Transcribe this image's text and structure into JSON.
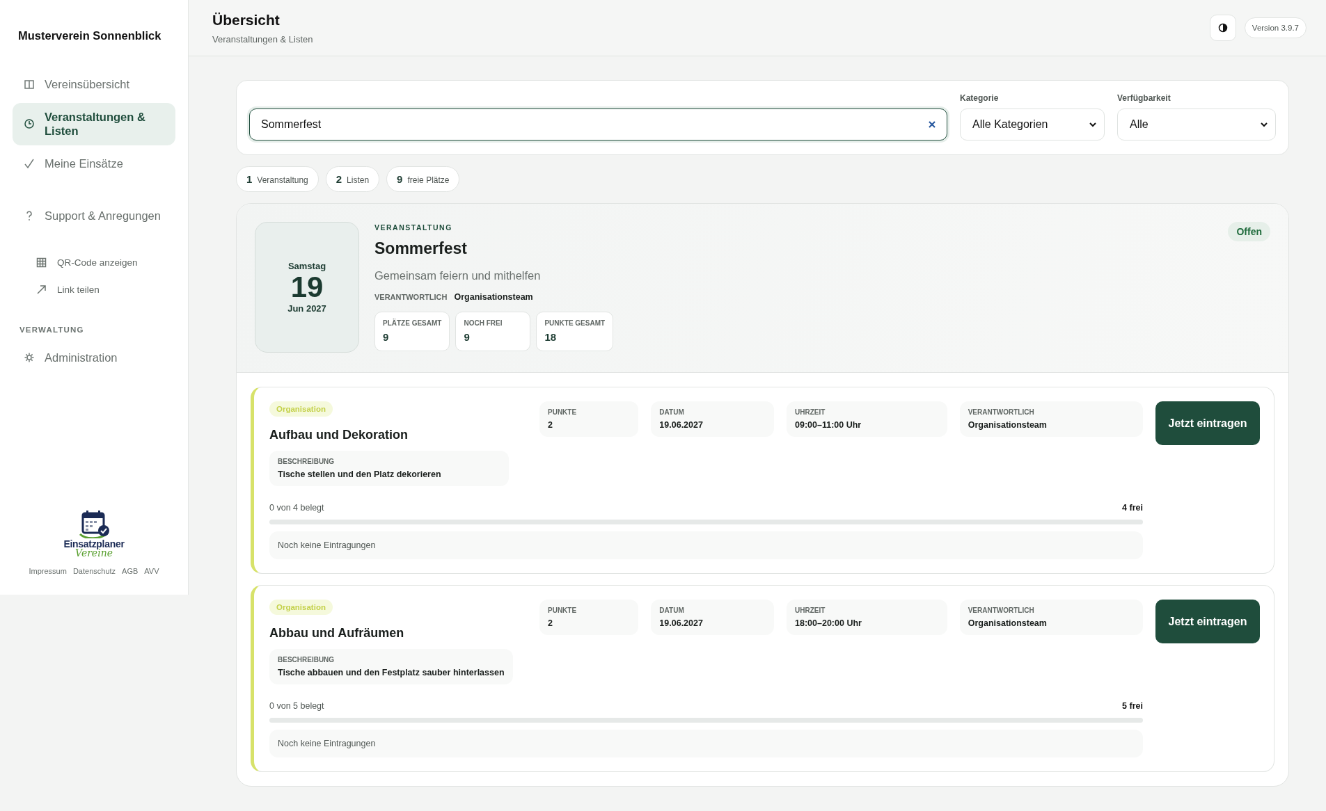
{
  "sidebar": {
    "club_name": "Musterverein Sonnenblick",
    "nav": [
      {
        "label": "Vereinsübersicht",
        "selected": false
      },
      {
        "label": "Veranstaltungen & Listen",
        "selected": true
      },
      {
        "label": "Meine Einsätze",
        "selected": false
      },
      {
        "label": "Support & Anregungen",
        "selected": false
      }
    ],
    "sub_links": [
      "QR-Code anzeigen",
      "Link teilen"
    ],
    "section_title": "VERWALTUNG",
    "admin_items": [
      {
        "label": "Administration",
        "selected": false
      }
    ],
    "logo": {
      "line1": "Einsatzplaner",
      "line2": "Vereine"
    },
    "footer_links": [
      "Impressum",
      "Datenschutz",
      "AGB",
      "AVV"
    ]
  },
  "header": {
    "title": "Übersicht",
    "subtitle": "Veranstaltungen & Listen",
    "version": "Version 3.9.7"
  },
  "filters": {
    "search": {
      "value": "Sommerfest"
    },
    "category": {
      "label": "Kategorie",
      "value": "Alle Kategorien"
    },
    "availability": {
      "label": "Verfügbarkeit",
      "value": "Alle"
    }
  },
  "summary": [
    {
      "count": "1",
      "label": "Veranstaltung"
    },
    {
      "count": "2",
      "label": "Listen"
    },
    {
      "count": "9",
      "label": "freie Plätze"
    }
  ],
  "event": {
    "weekday": "Samstag",
    "day": "19",
    "month_year": "Jun 2027",
    "eyebrow": "VERANSTALTUNG",
    "title": "Sommerfest",
    "description": "Gemeinsam feiern und mithelfen",
    "responsible_label": "VERANTWORTLICH",
    "responsible": "Organisationsteam",
    "status": "Offen",
    "stats": [
      {
        "label": "PLÄTZE GESAMT",
        "value": "9"
      },
      {
        "label": "NOCH FREI",
        "value": "9"
      },
      {
        "label": "PUNKTE GESAMT",
        "value": "18"
      }
    ],
    "lists": [
      {
        "tag": "Organisation",
        "title": "Aufbau und Dekoration",
        "description_label": "BESCHREIBUNG",
        "description": "Tische stellen und den Platz dekorieren",
        "info": [
          {
            "label": "PUNKTE",
            "value": "2"
          },
          {
            "label": "DATUM",
            "value": "19.06.2027"
          },
          {
            "label": "UHRZEIT",
            "value": "09:00–11:00 Uhr"
          },
          {
            "label": "VERANTWORTLICH",
            "value": "Organisationsteam"
          }
        ],
        "occupancy": "0 von 4 belegt",
        "free": "4 frei",
        "level": 0,
        "entries": "Noch keine Eintragungen",
        "button": "Jetzt eintragen"
      },
      {
        "tag": "Organisation",
        "title": "Abbau und Aufräumen",
        "description_label": "BESCHREIBUNG",
        "description": "Tische abbauen und den Festplatz sauber hinterlassen",
        "info": [
          {
            "label": "PUNKTE",
            "value": "2"
          },
          {
            "label": "DATUM",
            "value": "19.06.2027"
          },
          {
            "label": "UHRZEIT",
            "value": "18:00–20:00 Uhr"
          },
          {
            "label": "VERANTWORTLICH",
            "value": "Organisationsteam"
          }
        ],
        "occupancy": "0 von 5 belegt",
        "free": "5 frei",
        "level": 0,
        "entries": "Noch keine Eintragungen",
        "button": "Jetzt eintragen"
      }
    ]
  }
}
